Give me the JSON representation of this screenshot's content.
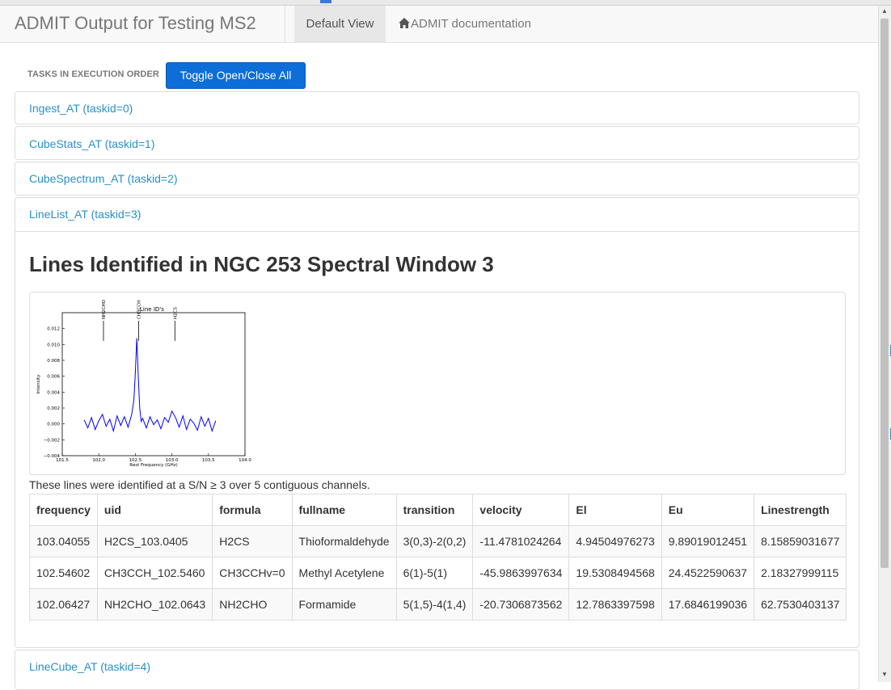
{
  "navbar": {
    "brand": "ADMIT Output for Testing MS2",
    "default_view": "Default View",
    "documentation": "ADMIT documentation",
    "home_icon": "home-icon"
  },
  "toolbar": {
    "label": "TASKS IN EXECUTION ORDER",
    "toggle_button": "Toggle Open/Close All"
  },
  "tasks": [
    {
      "title": "Ingest_AT (taskid=0)"
    },
    {
      "title": "CubeStats_AT (taskid=1)"
    },
    {
      "title": "CubeSpectrum_AT (taskid=2)"
    },
    {
      "title": "LineList_AT (taskid=3)"
    },
    {
      "title": "LineCube_AT (taskid=4)"
    }
  ],
  "linelist": {
    "heading": "Lines Identified in NGC 253 Spectral Window 3",
    "note": "These lines were identified at a S/N ≥ 3 over 5 contiguous channels.",
    "columns": [
      "frequency",
      "uid",
      "formula",
      "fullname",
      "transition",
      "velocity",
      "El",
      "Eu",
      "Linestrength"
    ],
    "rows": [
      [
        "103.04055",
        "H2CS_103.0405",
        "H2CS",
        "Thioformaldehyde",
        "3(0,3)-2(0,2)",
        "-11.4781024264",
        "4.94504976273",
        "9.89019012451",
        "8.15859031677"
      ],
      [
        "102.54602",
        "CH3CCH_102.5460",
        "CH3CCHv=0",
        "Methyl Acetylene",
        "6(1)-5(1)",
        "-45.9863997634",
        "19.5308494568",
        "24.4522590637",
        "2.18327999115"
      ],
      [
        "102.06427",
        "NH2CHO_102.0643",
        "NH2CHO",
        "Formamide",
        "5(1,5)-4(1,4)",
        "-20.7306873562",
        "12.7863397598",
        "17.6846199036",
        "62.7530403137"
      ]
    ]
  },
  "chart_data": {
    "type": "line",
    "title": "Line ID's",
    "xlabel": "Rest Frequency (GHz)",
    "ylabel": "Intensity",
    "xlim": [
      101.5,
      104.0
    ],
    "ylim": [
      -0.004,
      0.014
    ],
    "x_ticks": [
      "101.5",
      "102.0",
      "102.5",
      "103.0",
      "103.5",
      "104.0"
    ],
    "y_ticks": [
      "−0.004",
      "−0.002",
      "0.000",
      "0.002",
      "0.004",
      "0.006",
      "0.008",
      "0.010",
      "0.012"
    ],
    "line_markers": [
      {
        "label": "NH2CHO",
        "x": 102.064
      },
      {
        "label": "CH3CCH",
        "x": 102.546
      },
      {
        "label": "H2CS",
        "x": 103.041
      }
    ],
    "series": [
      {
        "color": "#0000ff",
        "x": [
          101.8,
          101.85,
          101.9,
          101.95,
          102.0,
          102.05,
          102.1,
          102.15,
          102.2,
          102.25,
          102.3,
          102.35,
          102.4,
          102.45,
          102.48,
          102.5,
          102.52,
          102.54,
          102.56,
          102.58,
          102.6,
          102.65,
          102.7,
          102.75,
          102.8,
          102.85,
          102.9,
          102.95,
          103.0,
          103.05,
          103.1,
          103.15,
          103.2,
          103.25,
          103.3,
          103.35,
          103.4,
          103.45,
          103.5,
          103.55,
          103.6
        ],
        "y": [
          0.0005,
          -0.0005,
          0.0008,
          -0.0007,
          0.0004,
          0.0012,
          -0.0003,
          0.0006,
          -0.0009,
          0.001,
          -0.0002,
          0.0009,
          -0.0004,
          0.0012,
          0.003,
          0.0065,
          0.0108,
          0.006,
          0.002,
          0.0003,
          0.0007,
          -0.0005,
          0.0009,
          -0.0001,
          0.0005,
          -0.0006,
          0.0008,
          0.0002,
          0.0016,
          0.0008,
          -0.0004,
          0.001,
          -0.0007,
          0.0006,
          0.0001,
          -0.0008,
          0.0009,
          -0.0003,
          0.0007,
          -0.0009,
          0.0004
        ]
      }
    ]
  }
}
